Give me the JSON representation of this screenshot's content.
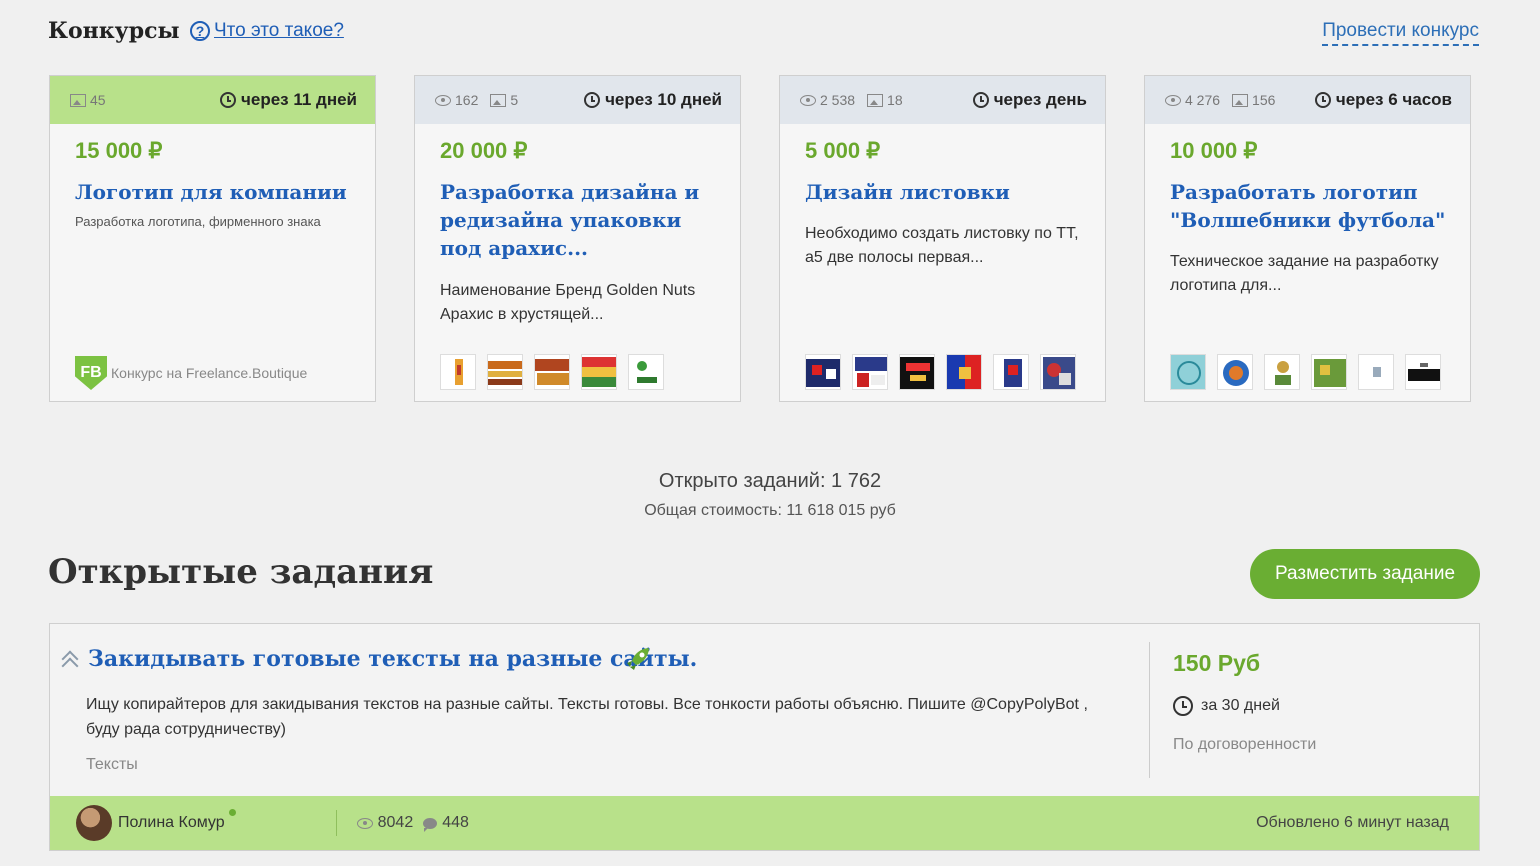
{
  "header": {
    "title": "Конкурсы",
    "what_link": "Что это такое?",
    "hold_contest": "Провести конкурс"
  },
  "contests": [
    {
      "views": "",
      "images": "45",
      "deadline": "через 11 дней",
      "price": "15 000 ₽",
      "title": "Логотип для компании",
      "description": "Разработка логотипа, фирменного знака",
      "badge": "Конкурс на Freelance.Boutique",
      "badge_logo_text": "FB"
    },
    {
      "views": "162",
      "images": "5",
      "deadline": "через 10 дней",
      "price": "20 000 ₽",
      "title": "Разработка дизайна и редизайна упаковки под арахис...",
      "description": "Наименование Бренд Golden Nuts Арахис в хрустящей..."
    },
    {
      "views": "2 538",
      "images": "18",
      "deadline": "через день",
      "price": "5 000 ₽",
      "title": "Дизайн листовки",
      "description": "Необходимо создать листовку по ТТ, а5 две полосы первая..."
    },
    {
      "views": "4 276",
      "images": "156",
      "deadline": "через 6 часов",
      "price": "10 000 ₽",
      "title": "Разработать логотип \"Волшебники футбола\"",
      "description": "Техническое задание на разработку логотипа для..."
    }
  ],
  "summary": {
    "open_tasks": "Открыто заданий: 1 762",
    "total_cost": "Общая стоимость: 11 618 015 руб"
  },
  "open_tasks": {
    "title": "Открытые задания",
    "post_button": "Разместить задание"
  },
  "task": {
    "title": "Закидывать готовые тексты на разные сайты.",
    "description": "Ищу копирайтеров для закидывания текстов на разные сайты. Тексты готовы. Все тонкости работы объясню. Пишите @CopyPolyBot , буду рада сотрудничеству)",
    "category": "Тексты",
    "price": "150 Руб",
    "term": "за 30 дней",
    "negotiation": "По договоренности",
    "author": "Полина Комур",
    "views": "8042",
    "responses": "448",
    "updated": "Обновлено 6 минут назад"
  },
  "colors": {
    "accent_green": "#6aae33",
    "link_blue": "#1f5eb6",
    "highlight_green": "#b8e18a"
  }
}
